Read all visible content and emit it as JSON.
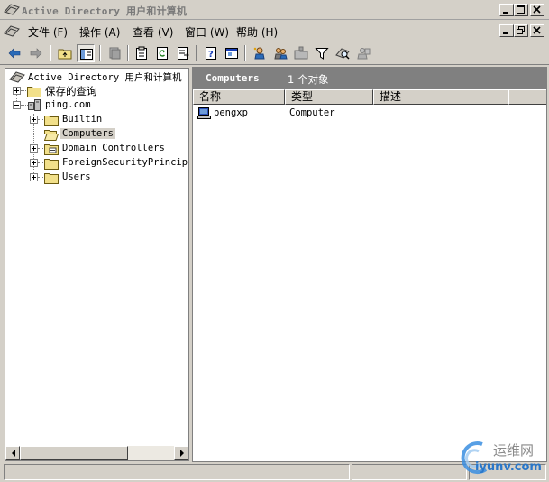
{
  "window": {
    "title": "Active Directory 用户和计算机"
  },
  "menu": {
    "items": [
      {
        "label": "文件 (F)"
      },
      {
        "label": "操作 (A)"
      },
      {
        "label": "查看 (V)"
      },
      {
        "label": "窗口 (W)"
      },
      {
        "label": "帮助 (H)"
      }
    ]
  },
  "toolbar": {
    "icons": [
      "back-arrow-icon",
      "forward-arrow-icon",
      "up-folder-icon",
      "show-tree-icon",
      "delete-icon",
      "properties-icon",
      "refresh-icon",
      "export-list-icon",
      "help-icon",
      "console-icon",
      "create-user-icon",
      "create-group-icon",
      "create-ou-icon",
      "filter-icon",
      "find-icon",
      "add-to-group-icon"
    ]
  },
  "tree": {
    "root": "Active Directory 用户和计算机",
    "saved_queries": "保存的查询",
    "domain": "ping.com",
    "children": [
      "Builtin",
      "Computers",
      "Domain Controllers",
      "ForeignSecurityPrincipa",
      "Users"
    ]
  },
  "details": {
    "container": "Computers",
    "count": "1 个对象",
    "columns": [
      "名称",
      "类型",
      "描述"
    ],
    "rows": [
      {
        "name": "pengxp",
        "type": "Computer",
        "description": ""
      }
    ]
  },
  "watermark": {
    "cn": "运维网",
    "url": "iyunv.com"
  },
  "colors": {
    "face": "#d4d0c8",
    "header": "#808080",
    "folder": "#f2e08a"
  }
}
